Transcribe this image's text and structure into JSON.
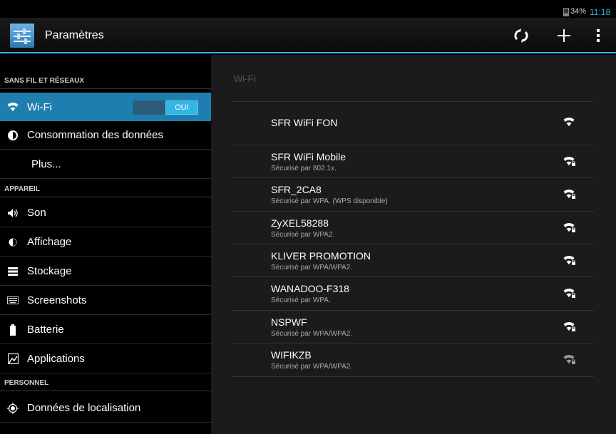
{
  "status": {
    "battery": "34%",
    "time": "11:18"
  },
  "actionbar": {
    "title": "Paramètres"
  },
  "sidebar": {
    "sections": {
      "wireless": "SANS FIL ET RÉSEAUX",
      "device": "APPAREIL",
      "personal": "PERSONNEL"
    },
    "items": {
      "wifi": "Wi-Fi",
      "data": "Consommation des données",
      "more": "Plus...",
      "sound": "Son",
      "display": "Affichage",
      "storage": "Stockage",
      "screenshots": "Screenshots",
      "battery": "Batterie",
      "apps": "Applications",
      "location": "Données de localisation"
    },
    "wifi_toggle": "OUI"
  },
  "main": {
    "title": "Wi-Fi",
    "networks": [
      {
        "name": "SFR WiFi FON",
        "security": ""
      },
      {
        "name": "SFR WiFi Mobile",
        "security": "Sécurisé par 802.1x."
      },
      {
        "name": "SFR_2CA8",
        "security": "Sécurisé par WPA. (WPS disponible)"
      },
      {
        "name": "ZyXEL58288",
        "security": "Sécurisé par WPA2."
      },
      {
        "name": "KLIVER PROMOTION",
        "security": "Sécurisé par WPA/WPA2."
      },
      {
        "name": "WANADOO-F318",
        "security": "Sécurisé par WPA."
      },
      {
        "name": "NSPWF",
        "security": "Sécurisé par WPA/WPA2."
      },
      {
        "name": "WIFIKZB",
        "security": "Sécurisé par WPA/WPA2."
      }
    ]
  },
  "colors": {
    "accent": "#33b5e5",
    "active_item": "#1f7eb0"
  },
  "icons": {
    "app": "settings-sliders-icon",
    "scan": "wps-icon",
    "add": "plus-icon",
    "overflow": "overflow-menu-icon"
  }
}
